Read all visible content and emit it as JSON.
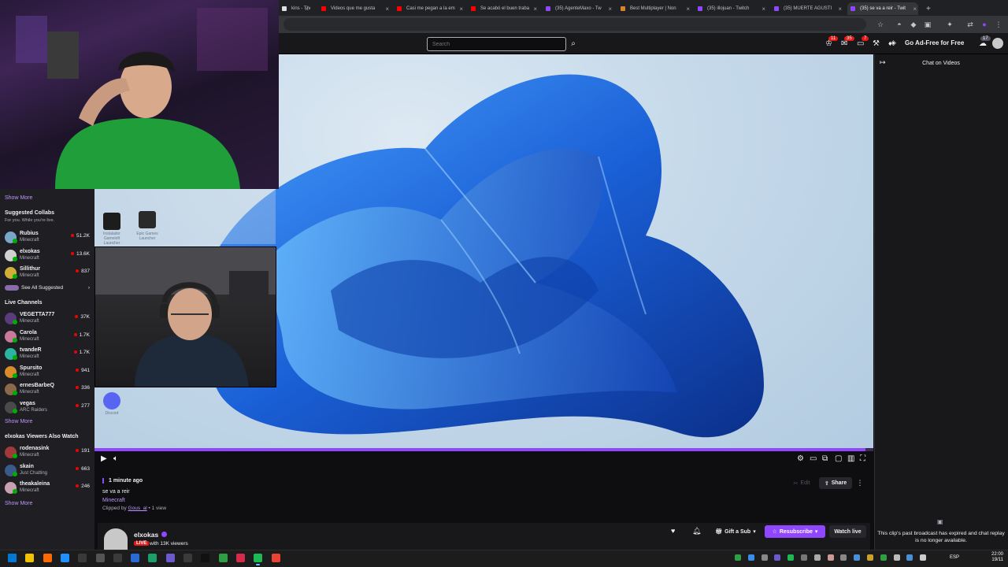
{
  "browser": {
    "tabs": [
      {
        "title": "kins - The",
        "color": "#e0e0e0"
      },
      {
        "title": "Videos que me gusta",
        "color": "#ff0000"
      },
      {
        "title": "Casi me pegan a la em",
        "color": "#ff0000"
      },
      {
        "title": "Se acabó el buen traba",
        "color": "#ff0000"
      },
      {
        "title": "(35) AgenteMaxo - Tw",
        "color": "#9147ff"
      },
      {
        "title": "Best Multiplayer | Non",
        "color": "#d9822b"
      },
      {
        "title": "(35) illojuan - Twitch",
        "color": "#9147ff"
      },
      {
        "title": "(35) MUERTE AGUSTI",
        "color": "#9147ff"
      },
      {
        "title": "(35) se va a reir - Twit",
        "color": "#9147ff"
      }
    ],
    "new_tab_glyph": "+"
  },
  "twitch": {
    "search_placeholder": "Search",
    "badges": {
      "notifications": "11",
      "inbox": "35",
      "activity": "7",
      "avatar": "17"
    },
    "ad_free_label": "Go Ad-Free for Free"
  },
  "sidebar": {
    "show_more_1": "Show More",
    "suggested_collabs": {
      "heading": "Suggested Collabs",
      "subtitle": "For you. While you're live.",
      "items": [
        {
          "name": "Rubius",
          "game": "Minecraft",
          "viewers": "51.2K",
          "color": "#7aa6c8"
        },
        {
          "name": "elxokas",
          "game": "Minecraft",
          "viewers": "13.6K",
          "color": "#d0d0d0"
        },
        {
          "name": "Sillithur",
          "game": "Minecraft",
          "viewers": "837",
          "color": "#cfae3a"
        }
      ],
      "see_all": "See All Suggested"
    },
    "live_channels": {
      "heading": "Live Channels",
      "items": [
        {
          "name": "VEGETTA777",
          "game": "Minecraft",
          "viewers": "37K",
          "color": "#5b3b7a"
        },
        {
          "name": "Carola",
          "game": "Minecraft",
          "viewers": "1.7K",
          "color": "#c97a9b"
        },
        {
          "name": "tvandeR",
          "game": "Minecraft",
          "viewers": "1.7K",
          "color": "#2cb5a0"
        },
        {
          "name": "Spursito",
          "game": "Minecraft",
          "viewers": "941",
          "color": "#d98b2a"
        },
        {
          "name": "ernesBarbeQ",
          "game": "Minecraft",
          "viewers": "336",
          "color": "#8a6a4a"
        },
        {
          "name": "vegas",
          "game": "ARC Raiders",
          "viewers": "277",
          "color": "#4a4a4a"
        }
      ],
      "show_more": "Show More"
    },
    "also_watch": {
      "heading": "elxokas Viewers Also Watch",
      "items": [
        {
          "name": "rodenasink",
          "game": "Minecraft",
          "viewers": "191",
          "color": "#a03a3a"
        },
        {
          "name": "skain",
          "game": "Just Chatting",
          "viewers": "663",
          "color": "#3a5a8a"
        },
        {
          "name": "theakaleina",
          "game": "Minecraft",
          "viewers": "246",
          "color": "#c9a0b0"
        }
      ],
      "show_more": "Show More"
    }
  },
  "video": {
    "progress_percent": 99,
    "desktop_icons": [
      {
        "label": "Instalador Gameloft Launcher"
      },
      {
        "label": "Epic Games Launcher"
      },
      {
        "label": "Discord"
      }
    ]
  },
  "clip": {
    "timestamp": "1 minute ago",
    "title": "se va a reir",
    "game": "Minecraft",
    "clipped_by_prefix": "Clipped by",
    "clipped_by_user": "Gous_al",
    "views": " • 1 view",
    "edit_label": "Edit",
    "share_label": "Share"
  },
  "channel": {
    "name": "elxokas",
    "live_label": "LIVE",
    "viewers_text": "with 13K viewers",
    "gift_label": "Gift a Sub",
    "resubscribe_label": "Resubscribe",
    "watch_live_label": "Watch live"
  },
  "chat": {
    "title": "Chat on Videos",
    "expired_message": "This clip's past broadcast has expired and chat replay is no longer available."
  },
  "taskbar": {
    "language": "ESP",
    "time": "22:00",
    "date": "19/11"
  }
}
